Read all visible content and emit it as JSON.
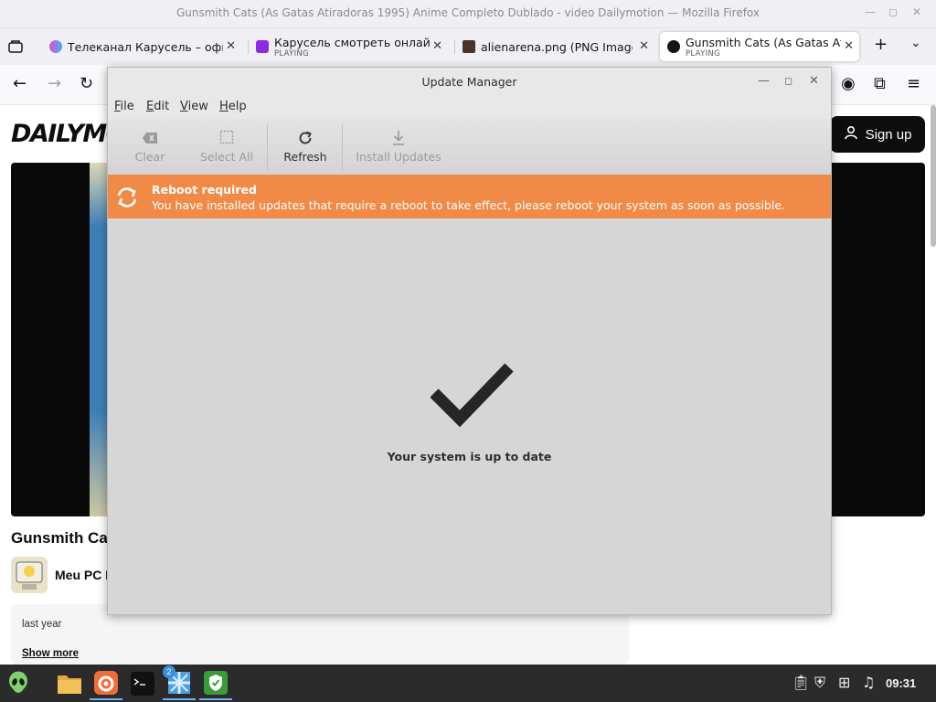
{
  "firefox": {
    "window_title": "Gunsmith Cats (As Gatas Atiradoras 1995) Anime Completo Dublado - video Dailymotion — Mozilla Firefox",
    "tabs": [
      {
        "label": "Телеканал Карусель – офи",
        "status": ""
      },
      {
        "label": "Карусель смотреть онлайн",
        "status": "PLAYING"
      },
      {
        "label": "alienarena.png (PNG Image,",
        "status": ""
      },
      {
        "label": "Gunsmith Cats (As Gatas Ati",
        "status": "PLAYING"
      }
    ]
  },
  "dailymotion": {
    "logo": "DAILYMO",
    "signup_label": "Sign up",
    "video_title": "Gunsmith Ca",
    "channel_name": "Meu PC D",
    "date": "last year",
    "show_more": "Show more"
  },
  "update_manager": {
    "title": "Update Manager",
    "menu": [
      {
        "key": "F",
        "rest": "ile"
      },
      {
        "key": "E",
        "rest": "dit"
      },
      {
        "key": "V",
        "rest": "iew"
      },
      {
        "key": "H",
        "rest": "elp"
      }
    ],
    "toolbar": {
      "clear": "Clear",
      "select_all": "Select All",
      "refresh": "Refresh",
      "install_updates": "Install Updates"
    },
    "banner": {
      "title": "Reboot required",
      "message": "You have installed updates that require a reboot to take effect, please reboot your system as soon as possible.",
      "color": "#f08a46"
    },
    "status": "Your system is up to date"
  },
  "taskbar": {
    "clock": "09:31",
    "badge_count": "2"
  }
}
